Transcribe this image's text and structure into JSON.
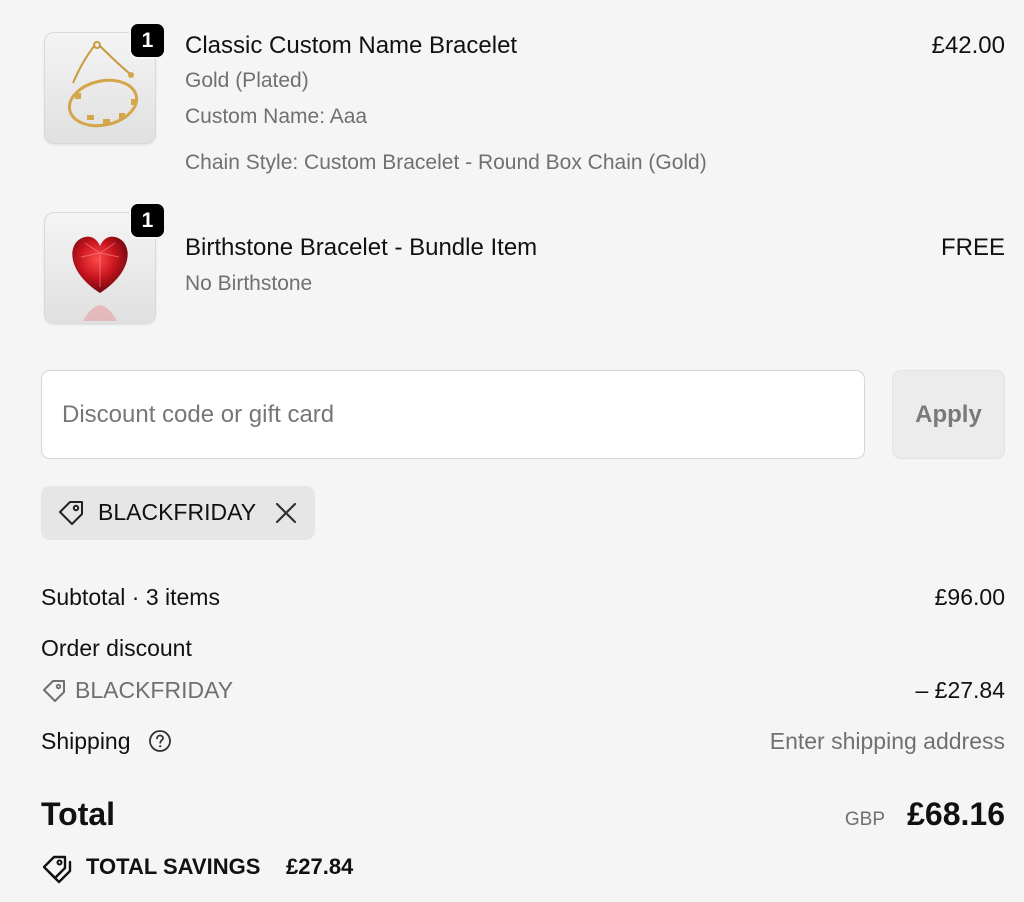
{
  "cart": {
    "items": [
      {
        "title": "Classic Custom Name Bracelet",
        "quantity": "1",
        "price": "£42.00",
        "variant": "Gold (Plated)",
        "custom_name": "Custom Name: Aaa",
        "chain_style": "Chain Style: Custom Bracelet - Round Box Chain (Gold)",
        "image_icon": "gold-bracelet-image"
      },
      {
        "title": "Birthstone Bracelet - Bundle Item",
        "quantity": "1",
        "price": "FREE",
        "variant": "No Birthstone",
        "image_icon": "red-heart-gem-image"
      }
    ]
  },
  "discount": {
    "placeholder": "Discount code or gift card",
    "value": "",
    "apply_label": "Apply",
    "applied_code": "BLACKFRIDAY",
    "tag_icon": "tag-icon",
    "remove_icon": "close-icon"
  },
  "summary": {
    "subtotal_label": "Subtotal · 3 items",
    "subtotal_value": "£96.00",
    "order_discount_label": "Order discount",
    "discount_code": "BLACKFRIDAY",
    "discount_value": "– £27.84",
    "shipping_label": "Shipping",
    "shipping_value": "Enter shipping address",
    "total_label": "Total",
    "currency": "GBP",
    "total_value": "£68.16",
    "savings_label": "TOTAL SAVINGS",
    "savings_value": "£27.84"
  },
  "colors": {
    "background": "#f5f5f5",
    "text": "#111111",
    "muted_text": "#707070",
    "badge": "#000000",
    "gem": "#c8141e",
    "gold": "#d4a64a"
  }
}
